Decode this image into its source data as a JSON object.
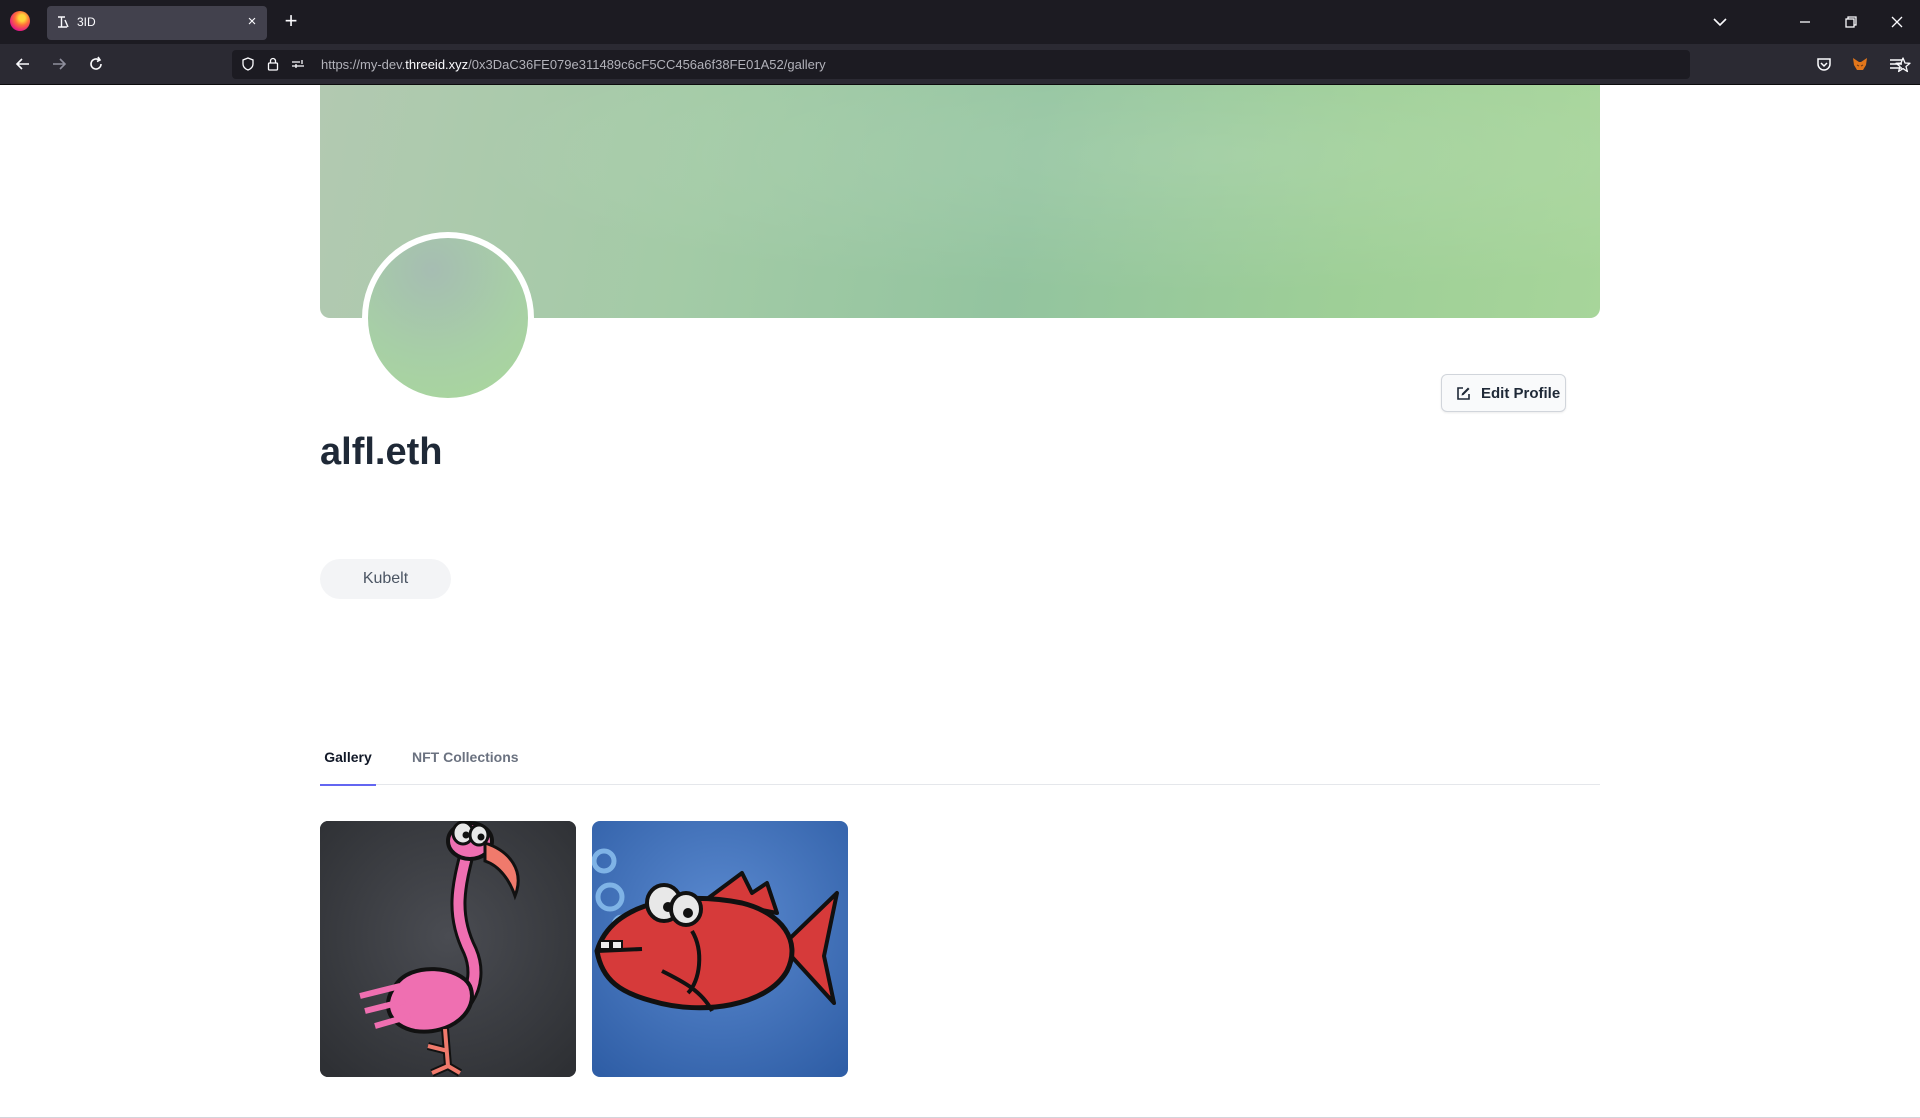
{
  "browser": {
    "tab_title": "3ID",
    "tab_close": "×",
    "new_tab": "+",
    "url_prefix": "https://my-dev.",
    "url_host": "threeid.xyz",
    "url_path": "/0x3DaC36FE079e311489c6cF5CC456a6f38FE01A52/gallery"
  },
  "profile": {
    "username": "alfl.eth",
    "edit_button": "Edit Profile",
    "organization_pill": "Kubelt"
  },
  "tabs": [
    {
      "label": "Gallery",
      "active": true
    },
    {
      "label": "NFT Collections",
      "active": false
    }
  ],
  "gallery": [
    {
      "name": "flamingo-painting",
      "bg": "#3b3d42"
    },
    {
      "name": "red-fish-painting",
      "bg": "#3f6fb3"
    }
  ],
  "colors": {
    "accent": "#6366f1",
    "cover_green": "#9fcd9c"
  }
}
